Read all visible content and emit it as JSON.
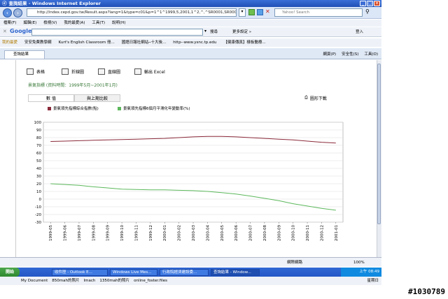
{
  "window": {
    "title": "查詢結果 - Windows Internet Explorer"
  },
  "nav": {
    "address": "http://index.cepd.gov.tw/Result.aspx?lang=1&type=c01&p=1^1^1999,5,2001,1^2,^,^SR0001,SR0002,^",
    "search_placeholder": "Yahoo! Search"
  },
  "menu": {
    "items": [
      "檔案(F)",
      "編輯(E)",
      "檢視(V)",
      "我的最愛(A)",
      "工具(T)",
      "說明(H)"
    ]
  },
  "google": {
    "logo": "Google",
    "search_label": "搜尋",
    "more_label": "更多設定 »",
    "login_label": "登入"
  },
  "favorites": {
    "label": "我的最愛",
    "items": [
      "安安免費教學網",
      "Kurt's English Classroom 冊...",
      "國語日報社網站─十大後...",
      "http--www.ysnc.tp.edu",
      "【健康傳真】樣板醫療..."
    ]
  },
  "tabs": [
    {
      "label": "查詢結果"
    }
  ],
  "toolbar_right": {
    "items": [
      "網頁(P)",
      "安全性(S)",
      "工具(O)"
    ]
  },
  "content": {
    "options": [
      {
        "label": "表格",
        "icon": "table-icon"
      },
      {
        "label": "折線圖",
        "icon": "line-chart-icon"
      },
      {
        "label": "直線圖",
        "icon": "bar-chart-icon"
      },
      {
        "label": "輸出 Excel",
        "icon": "excel-icon"
      }
    ],
    "title": "景氣指標 (資料時間：1999年5月~2001年1月)",
    "view_tabs": [
      "數 值",
      "與上期比較"
    ],
    "print_label": "圖形下載"
  },
  "chart_data": {
    "type": "line",
    "x": [
      "1999-05",
      "1999-06",
      "1999-07",
      "1999-08",
      "1999-09",
      "1999-10",
      "1999-11",
      "1999-12",
      "2000-01",
      "2000-02",
      "2000-03",
      "2000-04",
      "2000-05",
      "2000-06",
      "2000-07",
      "2000-08",
      "2000-09",
      "2000-10",
      "2000-11",
      "2000-12",
      "2001-01"
    ],
    "series": [
      {
        "name": "景氣領先指標綜合指數(點)",
        "color": "#8b2a3a",
        "values": [
          75,
          75.5,
          76,
          76.5,
          77,
          77.5,
          78,
          78.5,
          79,
          80,
          81,
          81.5,
          81.5,
          81,
          80,
          79,
          78,
          77,
          75.5,
          74,
          73
        ]
      },
      {
        "name": "景氣領先指標6個月平滑化年變動率(%)",
        "color": "#5cb85c",
        "values": [
          20,
          19,
          18,
          16,
          14.5,
          13,
          12.5,
          12,
          12,
          11.5,
          11,
          10,
          8.5,
          6.5,
          4,
          1,
          -2,
          -6,
          -9,
          -12,
          -14.5
        ]
      }
    ],
    "yticks": [
      100,
      90,
      80,
      70,
      60,
      50,
      40,
      30,
      20,
      10,
      0,
      -10,
      -20,
      -30
    ],
    "ylim": [
      -30,
      100
    ]
  },
  "status": {
    "zone": "網際網路",
    "zoom": "100%"
  },
  "taskbar": {
    "start": "開始",
    "buttons": [
      "收件匣 - Outlook E...",
      "Windows Live Mes...",
      "行政院經濟建設委...",
      "查詢結果 - Window..."
    ],
    "tray_time": "上午 08:49",
    "tray_day": "星期日",
    "row2": [
      "My Document",
      "850mah的照片",
      "Imach",
      "1350mah的照片",
      "online_foster.files"
    ]
  },
  "watermark": "#1030789"
}
